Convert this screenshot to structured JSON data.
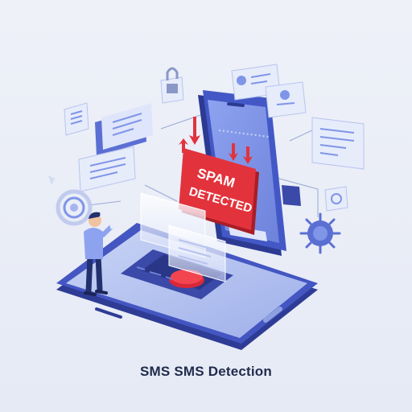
{
  "illustration": {
    "banner_line1": "SPAM",
    "banner_line2": "DETECTED"
  },
  "caption": "SMS SMS Detection",
  "colors": {
    "background": "#eaeef7",
    "device_blue": "#3d4fb5",
    "screen_blue": "#7f95e8",
    "alert_red": "#e2333d",
    "caption_text": "#1f2b4d"
  },
  "icons": [
    "padlock-icon",
    "id-card-icon",
    "message-bubble-icon",
    "bug-icon",
    "fingerprint-icon",
    "document-icon",
    "arrow-down-icon"
  ]
}
